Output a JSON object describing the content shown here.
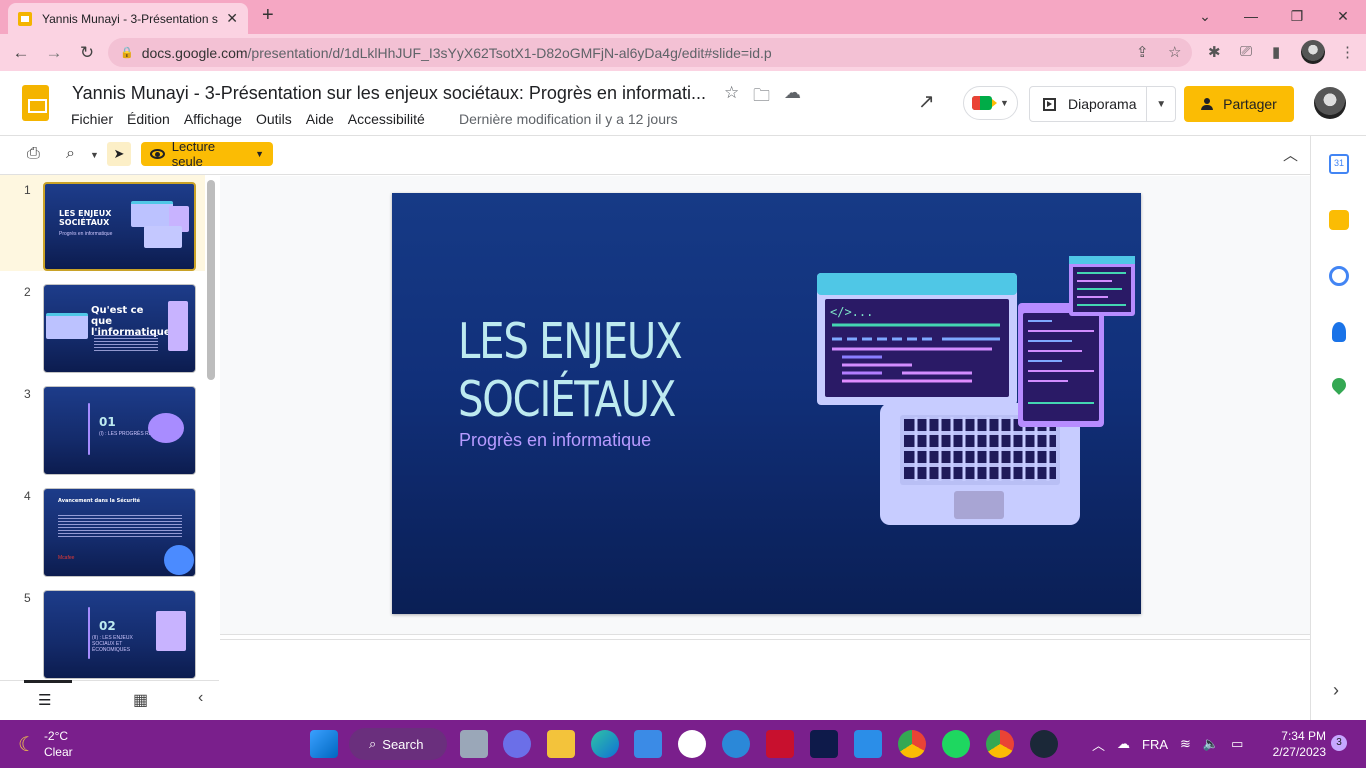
{
  "browser": {
    "tab_title": "Yannis Munayi - 3-Présentation s",
    "url_host": "docs.google.com",
    "url_path": "/presentation/d/1dLklHhJUF_I3sYyX62TsotX1-D82oGMFjN-al6yDa4g/edit#slide=id.p"
  },
  "docs": {
    "title": "Yannis Munayi - 3-Présentation sur les enjeux sociétaux: Progrès en informati...",
    "menu": [
      "Fichier",
      "Édition",
      "Affichage",
      "Outils",
      "Aide",
      "Accessibilité"
    ],
    "last_modified": "Dernière modification il y a 12 jours",
    "slideshow_label": "Diaporama",
    "share_label": "Partager",
    "readonly_label": "Lecture seule"
  },
  "filmstrip": {
    "slides": [
      {
        "num": "1",
        "title": "LES ENJEUX SOCIÉTAUX",
        "sub": "Progrès en informatique"
      },
      {
        "num": "2",
        "title": "Qu'est ce que l'informatique"
      },
      {
        "num": "3",
        "title": "01",
        "sub": "(I) : LES PROGRÈS RÉALISÉS"
      },
      {
        "num": "4",
        "title": "Avancement dans la Sécurité",
        "sub": "Mcafee"
      },
      {
        "num": "5",
        "title": "02",
        "sub": "(II) : LES ENJEUX SOCIAUX ET ÉCONOMIQUES"
      }
    ]
  },
  "slide": {
    "title_line1": "LES ENJEUX",
    "title_line2": "SOCIÉTAUX",
    "subtitle": "Progrès en informatique",
    "code_tag": "</>..."
  },
  "taskbar": {
    "temp": "-2°C",
    "weather": "Clear",
    "search_label": "Search",
    "lang": "FRA",
    "time": "7:34 PM",
    "date": "2/27/2023",
    "notif_count": "3"
  }
}
